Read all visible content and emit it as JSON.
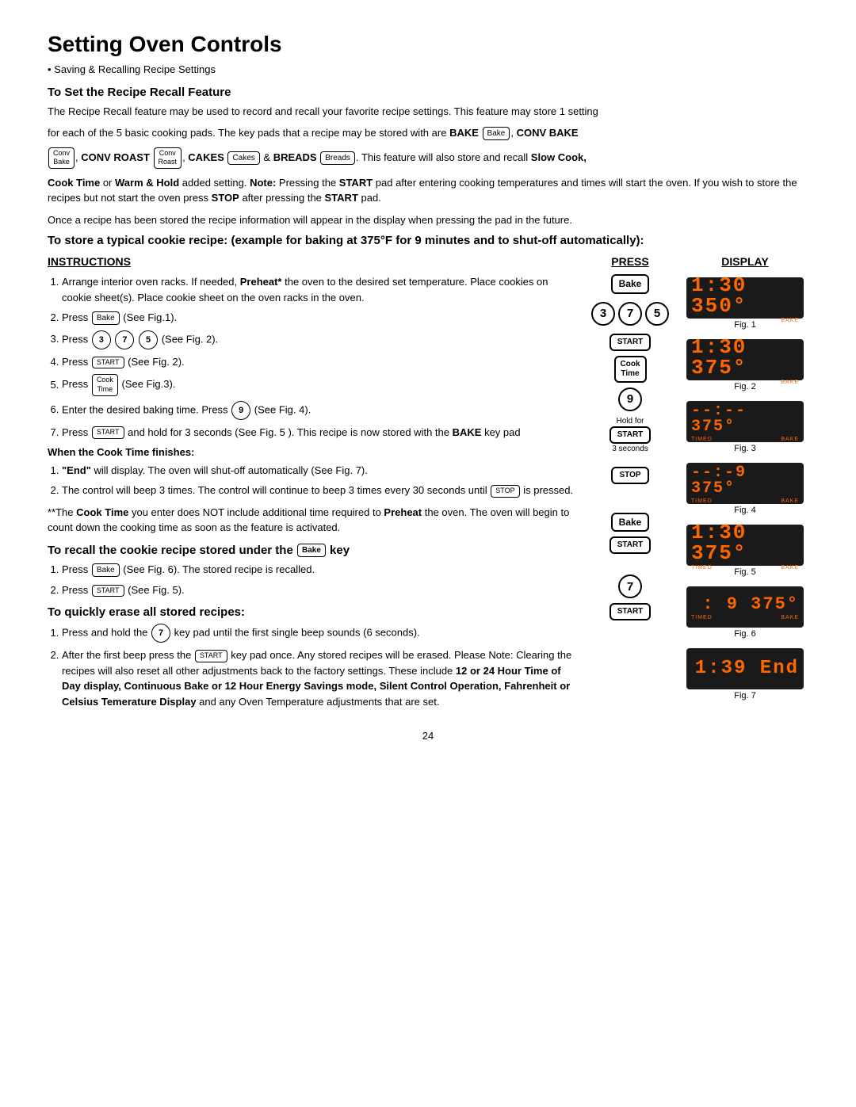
{
  "page": {
    "title": "Setting Oven Controls",
    "subtitle": "Saving & Recalling Recipe Settings",
    "page_number": "24"
  },
  "recipe_recall": {
    "heading": "To Set the Recipe Recall Feature",
    "para1": "The Recipe Recall feature may be used to record and recall your favorite recipe settings. This feature may store 1 setting",
    "para2": "for each of the 5 basic cooking pads. The key pads that a recipe may be stored with are BAKE",
    "para3": ", CONV BAKE",
    "para4": ", CONV ROAST",
    "para5": ", CAKES",
    "para6": "& BREADS",
    "para7": ". This feature will also store and recall Slow Cook,",
    "para8": "Cook Time or Warm & Hold added setting. Note: Pressing the START pad after entering cooking temperatures and times will start the oven. If you wish to store the recipes but not start the oven press STOP after pressing the START pad.",
    "para9": "Once a recipe has been stored  the recipe information will appear in the display when pressing the pad in the future."
  },
  "cookie_example": {
    "heading": "To store a typical cookie recipe: (example for baking at 375°F for 9 minutes and to shut-off automatically):"
  },
  "columns": {
    "instructions": "INSTRUCTIONS",
    "press": "PRESS",
    "display": "DISPLAY"
  },
  "steps": [
    {
      "num": "1",
      "text": "Arrange interior oven racks. If needed, Preheat* the oven to the desired set temperature. Place cookies on cookie sheet(s). Place cookie sheet on the oven racks in the oven."
    },
    {
      "num": "2",
      "text": "Press",
      "key": "Bake",
      "suffix": "(See Fig.1)."
    },
    {
      "num": "3",
      "text": "Press",
      "keys": [
        "3",
        "7",
        "5"
      ],
      "suffix": "(See Fig. 2)."
    },
    {
      "num": "4",
      "text": "Press",
      "key": "START",
      "suffix": "(See Fig. 2)."
    },
    {
      "num": "5",
      "text": "Press",
      "key": "Cook Time",
      "suffix": "(See Fig.3)."
    },
    {
      "num": "6",
      "text": "Enter the desired baking time. Press",
      "key": "9",
      "suffix": "(See Fig. 4)."
    },
    {
      "num": "7",
      "text": "Press",
      "key": "START",
      "suffix": "and hold for 3 seconds (See Fig. 5 ). This recipe is now stored with the BAKE key pad"
    }
  ],
  "when_cook_time": {
    "heading": "When the Cook Time finishes:",
    "items": [
      "\"End\" will display. The oven will shut-off automatically (See Fig. 7).",
      "The control will beep 3 times. The control will continue to beep 3 times every 30 seconds until",
      "is pressed."
    ]
  },
  "note_cook_time": "**The Cook Time you enter does NOT include additional time required to Preheat the oven. The oven will begin to count down the cooking time as soon as the feature is activated.",
  "recall_section": {
    "heading": "To recall the cookie recipe stored under the",
    "key": "Bake",
    "heading2": "key",
    "steps": [
      {
        "text": "Press",
        "key": "Bake",
        "suffix": "(See Fig. 6). The stored recipe is recalled."
      },
      {
        "text": "Press",
        "key": "START",
        "suffix": "(See Fig. 5)."
      }
    ]
  },
  "erase_section": {
    "heading": "To quickly erase all stored recipes:",
    "steps": [
      {
        "text": "Press and hold the",
        "key": "7",
        "suffix": "key pad until the first single beep sounds (6 seconds)."
      },
      {
        "text": "After the first beep press the",
        "key": "START",
        "suffix": "key pad once. Any stored recipes will be erased. Please Note: Clearing the recipes will also reset all other adjustments back to the factory settings. These include 12 or 24 Hour Time of Day display,  Continuous Bake or 12 Hour Energy Savings mode, Silent Control Operation, Fahrenheit or Celsius Temerature Display and any Oven Temperature adjustments that are set."
      }
    ]
  },
  "displays": [
    {
      "fig": "Fig. 1",
      "text": "1:30 350°",
      "labels": [
        "",
        "BAKE"
      ]
    },
    {
      "fig": "Fig. 2",
      "text": "1:30 375°",
      "labels": [
        "",
        "BAKE"
      ]
    },
    {
      "fig": "Fig. 3",
      "text": "- -:- -  375°",
      "labels": [
        "TIMED",
        "BAKE"
      ]
    },
    {
      "fig": "Fig. 4",
      "text": "- -:-9 375°",
      "labels": [
        "TIMED",
        "BAKE"
      ]
    },
    {
      "fig": "Fig. 5",
      "text": "1:30 375°",
      "labels": [
        "TIMED",
        "BAKE"
      ]
    },
    {
      "fig": "Fig. 6",
      "text": "  9 375°",
      "labels": [
        "TIMED",
        "BAKE"
      ]
    },
    {
      "fig": "Fig. 7",
      "text": "1:39 End",
      "labels": [
        "",
        ""
      ]
    }
  ]
}
